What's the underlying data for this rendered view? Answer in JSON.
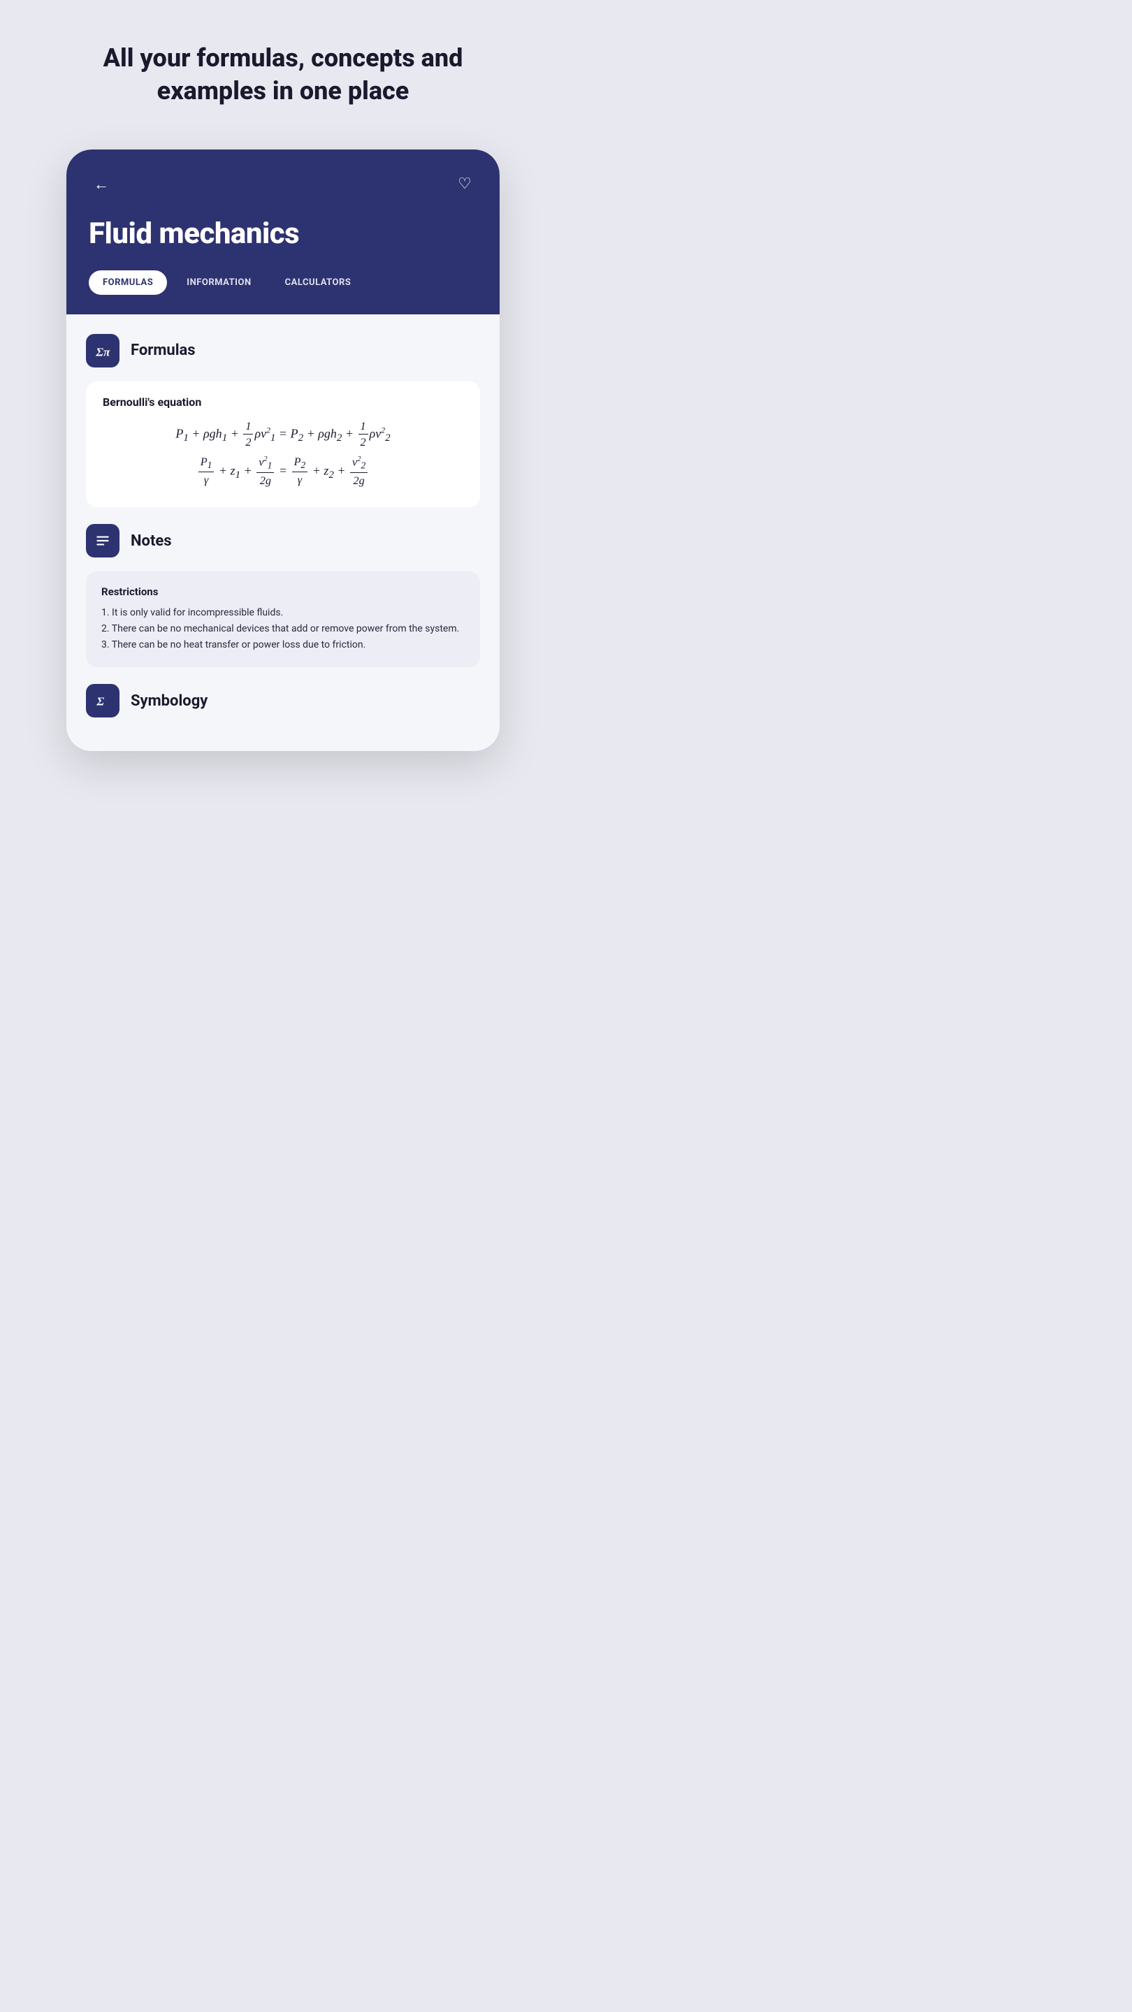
{
  "headline": "All your formulas, concepts and examples in one place",
  "header": {
    "back_label": "←",
    "heart_label": "♡",
    "title": "Fluid mechanics",
    "tabs": [
      {
        "label": "FORMULAS",
        "active": true
      },
      {
        "label": "INFORMATION",
        "active": false
      },
      {
        "label": "CALCULATORS",
        "active": false
      }
    ]
  },
  "sections": {
    "formulas": {
      "title": "Formulas",
      "formula_name": "Bernoulli's equation"
    },
    "notes": {
      "title": "Notes",
      "card": {
        "heading": "Restrictions",
        "items": [
          "1. It is only valid for incompressible fluids.",
          "2. There can be no mechanical devices that add or remove power from the system.",
          "3. There can be no heat transfer or power loss due to friction."
        ]
      }
    },
    "symbology": {
      "title": "Symbology"
    }
  },
  "colors": {
    "primary": "#2d3270",
    "background": "#e8e9f0",
    "content_bg": "#f5f6fa",
    "notes_card_bg": "#ecedf5"
  }
}
